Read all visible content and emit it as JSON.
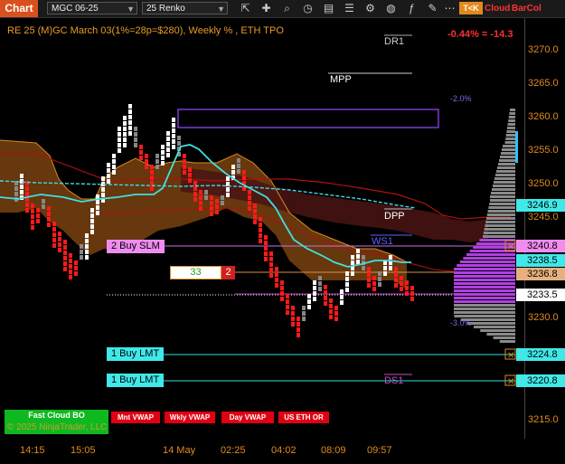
{
  "toolbar": {
    "chart_tab": "Chart",
    "instrument": "MGC 06-25",
    "bar_type": "25 Renko",
    "tok": "T<K",
    "cloud": "Cloud",
    "barcol": "BarCol",
    "icons": [
      "dropdown-icon",
      "dropdown-icon",
      "cursor-icon",
      "crosshair-icon",
      "zoom-icon",
      "time-icon",
      "data-box-icon",
      "properties-icon",
      "strategy-icon",
      "template-icon",
      "more-icon"
    ]
  },
  "chart": {
    "title": "RE 25 (M)GC March 03(1%=28p=$280), Weekly % , ETH TPO",
    "pct_change": "-0.44% = -14.3",
    "levels": {
      "dr1": "DR1",
      "mpp": "MPP",
      "dpp": "DPP",
      "ws1": "WS1",
      "ds1": "DS1",
      "pct_up": "-2.0%",
      "pct_down": "-3.0%"
    },
    "orders": [
      {
        "label": "2 Buy SLM",
        "price": "3240.8"
      },
      {
        "label": "1 Buy LMT",
        "price": "3224.8"
      },
      {
        "label": "1 Buy LMT",
        "price": "3220.8"
      }
    ],
    "position": {
      "qty": "33",
      "count": "2"
    },
    "price_tags": {
      "p1": "3246.9",
      "p2": "3240.8",
      "p3": "3238.5",
      "p4": "3236.8",
      "p5": "3233.5",
      "p6": "3224.8",
      "p7": "3220.8"
    },
    "y_ticks": [
      "3270.0",
      "3265.0",
      "3260.0",
      "3255.0",
      "3250.0",
      "3245.0",
      "3230.0",
      "3215.0"
    ],
    "x_ticks": [
      "14:15",
      "15:05",
      "14 May",
      "02:25",
      "04:02",
      "08:09",
      "09:57"
    ],
    "watermark": "© 2025 NinjaTrader, LLC",
    "colors": {
      "up": "#ffffff",
      "down": "#ff1a1a",
      "neutral": "#888888",
      "cloud_up": "#c87a1a",
      "cloud_down": "#7a1a1a",
      "vwap": "#40e0e0",
      "profile": "#b040e0"
    }
  },
  "buttons": {
    "fast_cloud": "Fast Cloud BO",
    "mnt_vwap": "Mnt VWAP",
    "wkly_vwap": "Wkly VWAP",
    "day_vwap": "Day VWAP",
    "us_eth_or": "US ETH OR"
  }
}
